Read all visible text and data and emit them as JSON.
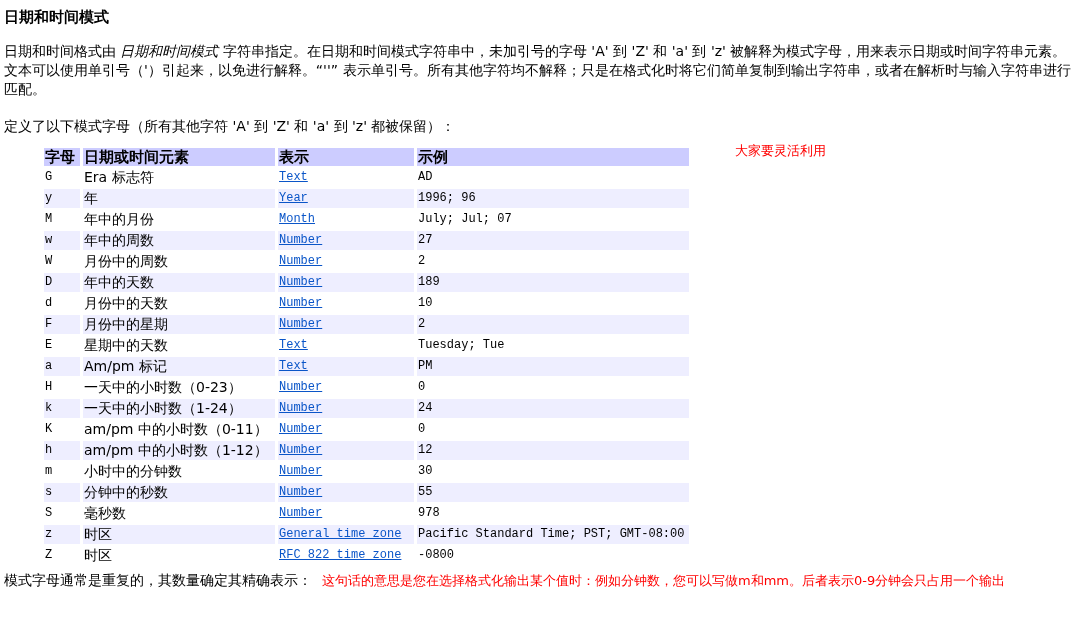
{
  "title": "日期和时间模式",
  "intro": "日期和时间格式由 *日期和时间模式* 字符串指定。在日期和时间模式字符串中，未加引号的字母 'A' 到 'Z' 和 'a' 到 'z' 被解释为模式字母，用来表示日期或时间字符串元素。文本可以使用单引号（'）引起来，以免进行解释。“''” 表示单引号。所有其他字符均不解释；只是在格式化时将它们简单复制到输出字符串，或者在解析时与输入字符串进行匹配。",
  "definition": "定义了以下模式字母（所有其他字符 'A' 到 'Z' 和 'a' 到 'z' 都被保留）：",
  "table": {
    "columns": [
      "字母",
      "日期或时间元素",
      "表示",
      "示例"
    ],
    "rows": [
      {
        "letter": "G",
        "element": "Era 标志符",
        "presentation": "Text",
        "example": "AD"
      },
      {
        "letter": "y",
        "element": "年",
        "presentation": "Year",
        "example": "1996; 96"
      },
      {
        "letter": "M",
        "element": "年中的月份",
        "presentation": "Month",
        "example": "July; Jul; 07"
      },
      {
        "letter": "w",
        "element": "年中的周数",
        "presentation": "Number",
        "example": "27"
      },
      {
        "letter": "W",
        "element": "月份中的周数",
        "presentation": "Number",
        "example": "2"
      },
      {
        "letter": "D",
        "element": "年中的天数",
        "presentation": "Number",
        "example": "189"
      },
      {
        "letter": "d",
        "element": "月份中的天数",
        "presentation": "Number",
        "example": "10"
      },
      {
        "letter": "F",
        "element": "月份中的星期",
        "presentation": "Number",
        "example": "2"
      },
      {
        "letter": "E",
        "element": "星期中的天数",
        "presentation": "Text",
        "example": "Tuesday; Tue"
      },
      {
        "letter": "a",
        "element": "Am/pm 标记",
        "presentation": "Text",
        "example": "PM"
      },
      {
        "letter": "H",
        "element": "一天中的小时数（0-23）",
        "presentation": "Number",
        "example": "0"
      },
      {
        "letter": "k",
        "element": "一天中的小时数（1-24）",
        "presentation": "Number",
        "example": "24"
      },
      {
        "letter": "K",
        "element": "am/pm 中的小时数（0-11）",
        "presentation": "Number",
        "example": "0"
      },
      {
        "letter": "h",
        "element": "am/pm 中的小时数（1-12）",
        "presentation": "Number",
        "example": "12"
      },
      {
        "letter": "m",
        "element": "小时中的分钟数",
        "presentation": "Number",
        "example": "30"
      },
      {
        "letter": "s",
        "element": "分钟中的秒数",
        "presentation": "Number",
        "example": "55"
      },
      {
        "letter": "S",
        "element": "毫秒数",
        "presentation": "Number",
        "example": "978"
      },
      {
        "letter": "z",
        "element": "时区",
        "presentation": "General time zone",
        "example": "Pacific Standard Time; PST; GMT-08:00"
      },
      {
        "letter": "Z",
        "element": "时区",
        "presentation": "RFC 822 time zone",
        "example": "-0800"
      }
    ]
  },
  "side_note": "大家要灵活利用",
  "footer": "模式字母通常是重复的，其数量确定其精确表示：",
  "footer_note": "这句话的意思是您在选择格式化输出某个值时：例如分钟数，您可以写做m和mm。后者表示0-9分钟会只占用一个输出"
}
